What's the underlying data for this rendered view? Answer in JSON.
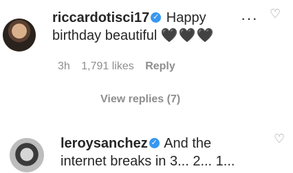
{
  "comments": [
    {
      "username": "riccardotisci17",
      "text_part1": "Happy",
      "text_part2": "birthday beautiful",
      "emoji": "🖤🖤🖤",
      "time": "3h",
      "likes": "1,791 likes",
      "reply_label": "Reply",
      "view_replies": "View replies (7)"
    },
    {
      "username": "leroysanchez",
      "text": "And the internet breaks in 3... 2... 1..."
    }
  ],
  "icons": {
    "verified": "✓",
    "more": "···",
    "heart_outline": "♡"
  }
}
